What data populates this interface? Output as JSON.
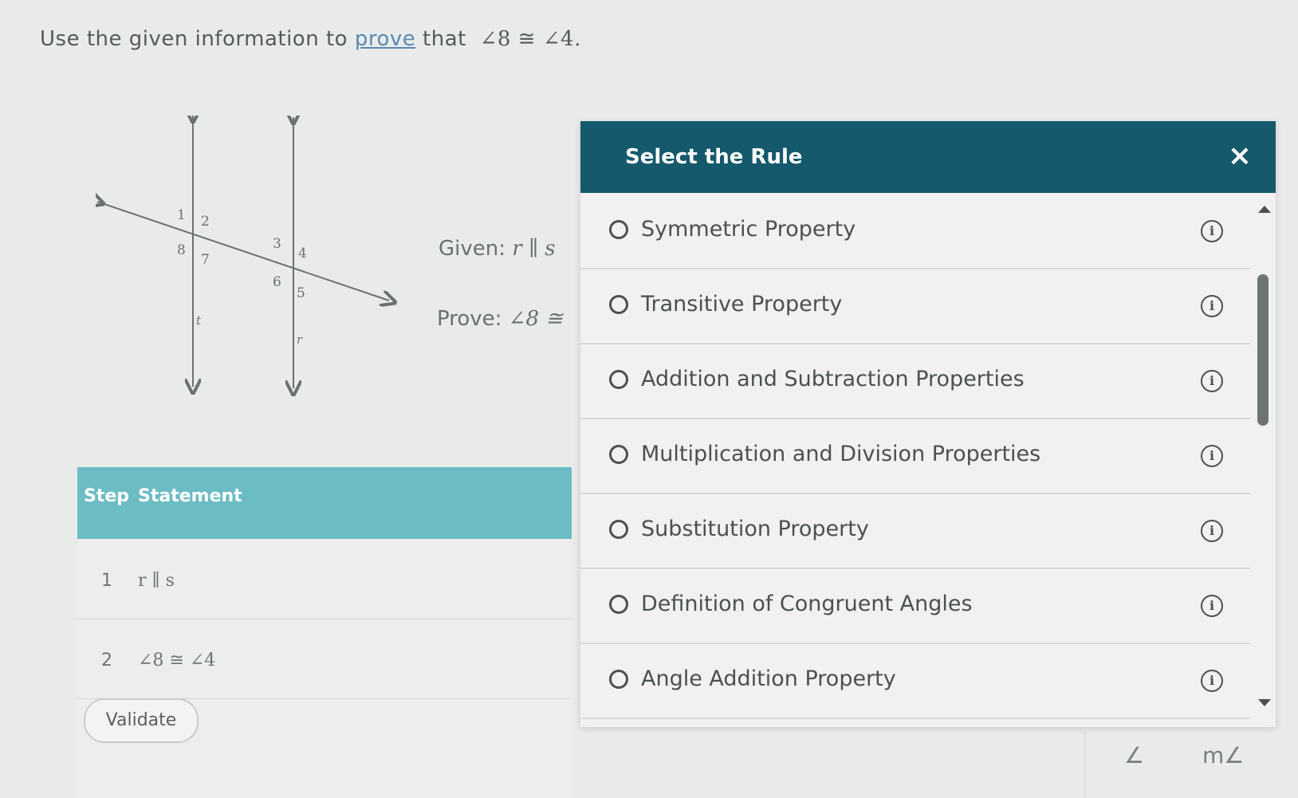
{
  "prompt": {
    "prefix": "Use the given information to",
    "link": "prove",
    "middle": "that",
    "math": "∠8 ≅ ∠4."
  },
  "figure": {
    "angle_labels": [
      "1",
      "2",
      "3",
      "4",
      "5",
      "6",
      "7",
      "8"
    ],
    "line_labels": [
      "t",
      "r"
    ]
  },
  "given": {
    "label": "Given:",
    "math": "r ∥ s"
  },
  "prove": {
    "label": "Prove:",
    "math": "∠8 ≅"
  },
  "proof_table": {
    "columns": [
      "Step",
      "Statement"
    ],
    "rows": [
      {
        "step": "1",
        "statement": "r ∥ s"
      },
      {
        "step": "2",
        "statement": "∠8 ≅ ∠4"
      }
    ],
    "validate_label": "Validate"
  },
  "modal": {
    "title": "Select the Rule",
    "close_icon": "×",
    "options": [
      {
        "label": "Symmetric Property",
        "info": "i"
      },
      {
        "label": "Transitive Property",
        "info": "i"
      },
      {
        "label": "Addition and Subtraction Properties",
        "info": "i"
      },
      {
        "label": "Multiplication and Division Properties",
        "info": "i"
      },
      {
        "label": "Substitution Property",
        "info": "i"
      },
      {
        "label": "Definition of Congruent Angles",
        "info": "i"
      },
      {
        "label": "Angle Addition Property",
        "info": "i"
      }
    ]
  },
  "toolbar": {
    "angle": "∠",
    "measure_angle": "m∠"
  },
  "colors": {
    "modal_header": "#15596c",
    "table_header": "#6cbcc4",
    "background": "#e9ebea",
    "link": "#5b8ab0"
  }
}
